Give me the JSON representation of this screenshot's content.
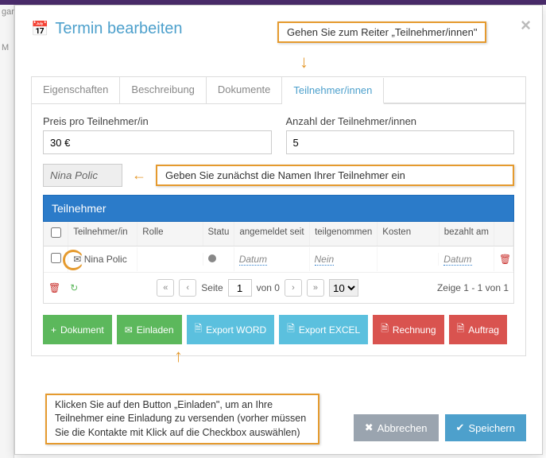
{
  "sidebar_stub": "gar",
  "sidebar_stub2": "M",
  "modal": {
    "title": "Termin bearbeiten"
  },
  "callouts": {
    "c1": "Gehen Sie zum Reiter „Teilnehmer/innen\"",
    "c2": "Geben Sie zunächst die Namen Ihrer Teilnehmer ein",
    "c3": "Klicken Sie auf den Button „Einladen\", um an Ihre Teilnehmer eine Einladung zu versenden (vorher müssen Sie die Kontakte mit Klick auf die Checkbox auswählen)"
  },
  "tabs": [
    "Eigenschaften",
    "Beschreibung",
    "Dokumente",
    "Teilnehmer/innen"
  ],
  "form": {
    "price_label": "Preis pro Teilnehmer/in",
    "price_value": "30 €",
    "count_label": "Anzahl der Teilnehmer/innen",
    "count_value": "5",
    "name_value": "Nina Polic"
  },
  "table": {
    "header": "Teilnehmer",
    "cols": {
      "cb": "",
      "name": "Teilnehmer/in",
      "role": "Rolle",
      "status": "Statu",
      "date1": "angemeldet seit",
      "teil": "teilgenommen",
      "kosten": "Kosten",
      "bez": "bezahlt am"
    },
    "row": {
      "name": "Nina Polic",
      "date1": "Datum",
      "teil": "Nein",
      "bez": "Datum"
    },
    "pager": {
      "page_label": "Seite",
      "page_value": "1",
      "of": "von 0",
      "per_page": "10",
      "range": "Zeige 1 - 1 von 1"
    }
  },
  "actions": {
    "dokument": "Dokument",
    "einladen": "Einladen",
    "word": "Export WORD",
    "excel": "Export EXCEL",
    "rechnung": "Rechnung",
    "auftrag": "Auftrag"
  },
  "footer": {
    "cancel": "Abbrechen",
    "save": "Speichern"
  }
}
